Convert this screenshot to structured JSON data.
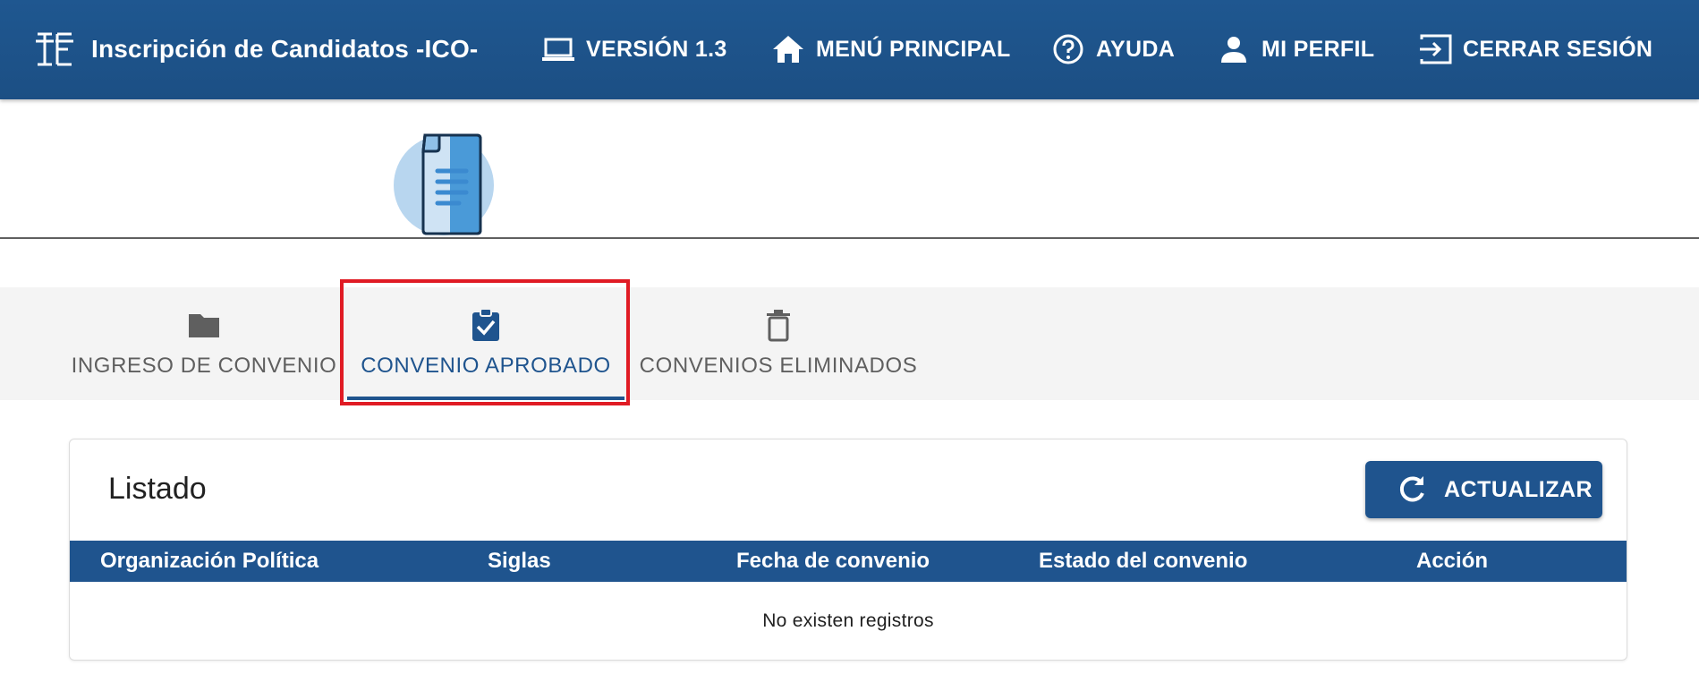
{
  "appbar": {
    "brand_title": "Inscripción de Candidatos -ICO-",
    "brand_logo": "tse-logo-icon",
    "nav": {
      "version": {
        "label": "VERSIÓN 1.3",
        "icon": "laptop-icon"
      },
      "menu": {
        "label": "MENÚ PRINCIPAL",
        "icon": "home-icon"
      },
      "help": {
        "label": "AYUDA",
        "icon": "help-circle-icon"
      },
      "profile": {
        "label": "MI PERFIL",
        "icon": "person-icon"
      },
      "logout": {
        "label": "CERRAR SESIÓN",
        "icon": "exit-icon"
      }
    },
    "background": "#1f5790"
  },
  "header": {
    "illustration": "document-icon"
  },
  "tabs": [
    {
      "label": "INGRESO DE CONVENIO",
      "icon": "folder-icon",
      "active": false
    },
    {
      "label": "CONVENIO APROBADO",
      "icon": "clipboard-check-icon",
      "active": true
    },
    {
      "label": "CONVENIOS ELIMINADOS",
      "icon": "trash-icon",
      "active": false
    }
  ],
  "card": {
    "title": "Listado",
    "refresh_label": "ACTUALIZAR",
    "table": {
      "columns": [
        "Organización Política",
        "Siglas",
        "Fecha de convenio",
        "Estado del convenio",
        "Acción"
      ],
      "rows": [],
      "empty_message": "No existen registros"
    }
  },
  "colors": {
    "primary": "#1f548e",
    "highlight": "#e01b24",
    "tab_bg": "#f4f4f4"
  }
}
